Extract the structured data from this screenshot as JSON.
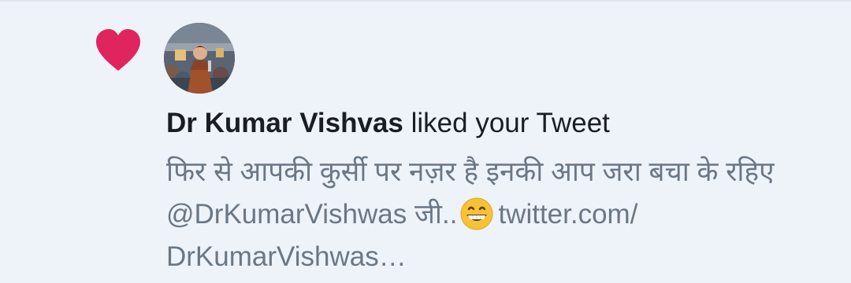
{
  "notification": {
    "type": "like",
    "icon": "heart-icon",
    "heart_color": "#e0245e",
    "avatar": "profile-photo-avatar",
    "author": "Dr Kumar Vishvas",
    "action": "liked your Tweet",
    "tweet_text_before_emoji": "फिर से आपकी कुर्सी पर नज़र है इनकी आप जरा बचा के रहिए @DrKumarVishwas जी..",
    "emoji": "grinning-face-emoji",
    "tweet_link_text": "twitter.com/",
    "tweet_link_rest": "DrKumarVishwas…"
  }
}
